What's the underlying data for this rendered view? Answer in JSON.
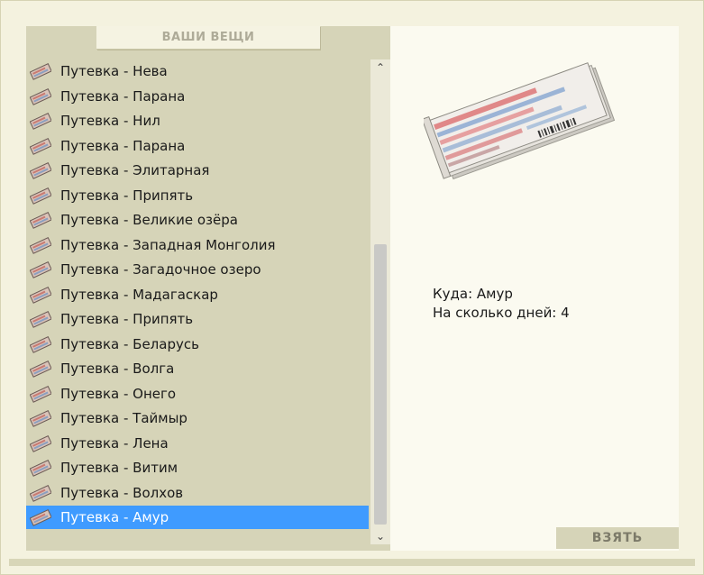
{
  "panel": {
    "header": "ВАШИ ВЕЩИ"
  },
  "items": [
    {
      "label": "Путевка - Нева"
    },
    {
      "label": "Путевка - Парана"
    },
    {
      "label": "Путевка - Нил"
    },
    {
      "label": "Путевка - Парана"
    },
    {
      "label": "Путевка - Элитарная"
    },
    {
      "label": "Путевка - Припять"
    },
    {
      "label": "Путевка - Великие озёра"
    },
    {
      "label": "Путевка - Западная Монголия"
    },
    {
      "label": "Путевка - Загадочное озеро"
    },
    {
      "label": "Путевка - Мадагаскар"
    },
    {
      "label": "Путевка - Припять"
    },
    {
      "label": "Путевка - Беларусь"
    },
    {
      "label": "Путевка - Волга"
    },
    {
      "label": "Путевка - Онего"
    },
    {
      "label": "Путевка - Таймыр"
    },
    {
      "label": "Путевка - Лена"
    },
    {
      "label": "Путевка - Витим"
    },
    {
      "label": "Путевка - Волхов"
    },
    {
      "label": "Путевка - Амур"
    }
  ],
  "selected_index": 18,
  "scrollbar": {
    "up_icon": "chevron-up-icon",
    "down_icon": "chevron-down-icon"
  },
  "details": {
    "destination": "Куда: Амур",
    "days": "На сколько дней: 4"
  },
  "actions": {
    "take_label": "ВЗЯТЬ"
  },
  "colors": {
    "selection": "#3f9bff",
    "panel": "#d6d4b8",
    "background": "#f4f2df"
  }
}
